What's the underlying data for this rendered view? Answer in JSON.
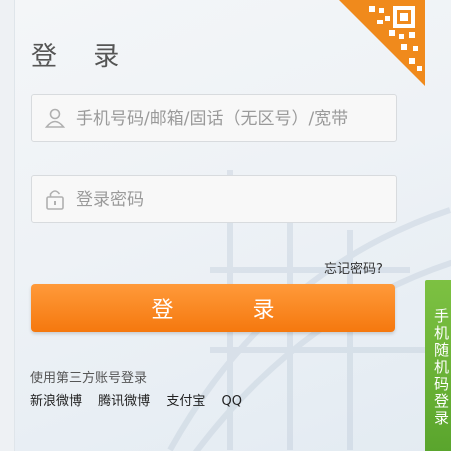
{
  "login": {
    "title": "登 录",
    "username_placeholder": "手机号码/邮箱/固话（无区号）/宽带",
    "password_placeholder": "登录密码",
    "forgot_password": "忘记密码?",
    "login_button": "登 录"
  },
  "third_party": {
    "label": "使用第三方账号登录",
    "providers": [
      "新浪微博",
      "腾讯微博",
      "支付宝",
      "QQ"
    ]
  },
  "side_tab": {
    "label": "手机随机码登录"
  },
  "colors": {
    "accent_orange": "#f5780e",
    "side_tab_green": "#6ab436",
    "qr_orange": "#f08a1c"
  },
  "icons": [
    "user-icon",
    "lock-icon",
    "qr-code-icon"
  ]
}
